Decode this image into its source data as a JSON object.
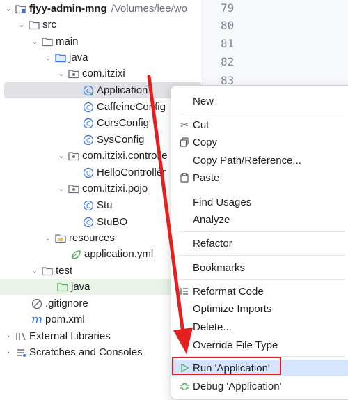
{
  "tree": {
    "root": {
      "name": "fjyy-admin-mng",
      "path": "/Volumes/lee/wo"
    },
    "src": "src",
    "main": "main",
    "java": "java",
    "pkg1": "com.itzixi",
    "application": "Application",
    "caffeine": "CaffeineConfig",
    "cors": "CorsConfig",
    "sys": "SysConfig",
    "pkg2": "com.itzixi.controlle",
    "hello": "HelloController",
    "pkg3": "com.itzixi.pojo",
    "stu": "Stu",
    "stubo": "StuBO",
    "resources": "resources",
    "appyml": "application.yml",
    "test": "test",
    "testjava": "java",
    "gitignore": ".gitignore",
    "pom": "pom.xml",
    "extlibs": "External Libraries",
    "scratches": "Scratches and Consoles"
  },
  "gutter": {
    "lines": [
      "79",
      "80",
      "81",
      "82",
      "83"
    ]
  },
  "menu": {
    "new": "New",
    "cut": "Cut",
    "copy": "Copy",
    "copy_path": "Copy Path/Reference...",
    "paste": "Paste",
    "find_usages": "Find Usages",
    "analyze": "Analyze",
    "refactor": "Refactor",
    "bookmarks": "Bookmarks",
    "reformat": "Reformat Code",
    "optimize": "Optimize Imports",
    "delete": "Delete...",
    "override": "Override File Type",
    "run": "Run 'Application'",
    "debug": "Debug 'Application'"
  },
  "colors": {
    "accent": "#3574f0",
    "highlight_box": "#e32020",
    "selection": "#dfe1e5",
    "menu_hover": "#d6e4ff"
  }
}
